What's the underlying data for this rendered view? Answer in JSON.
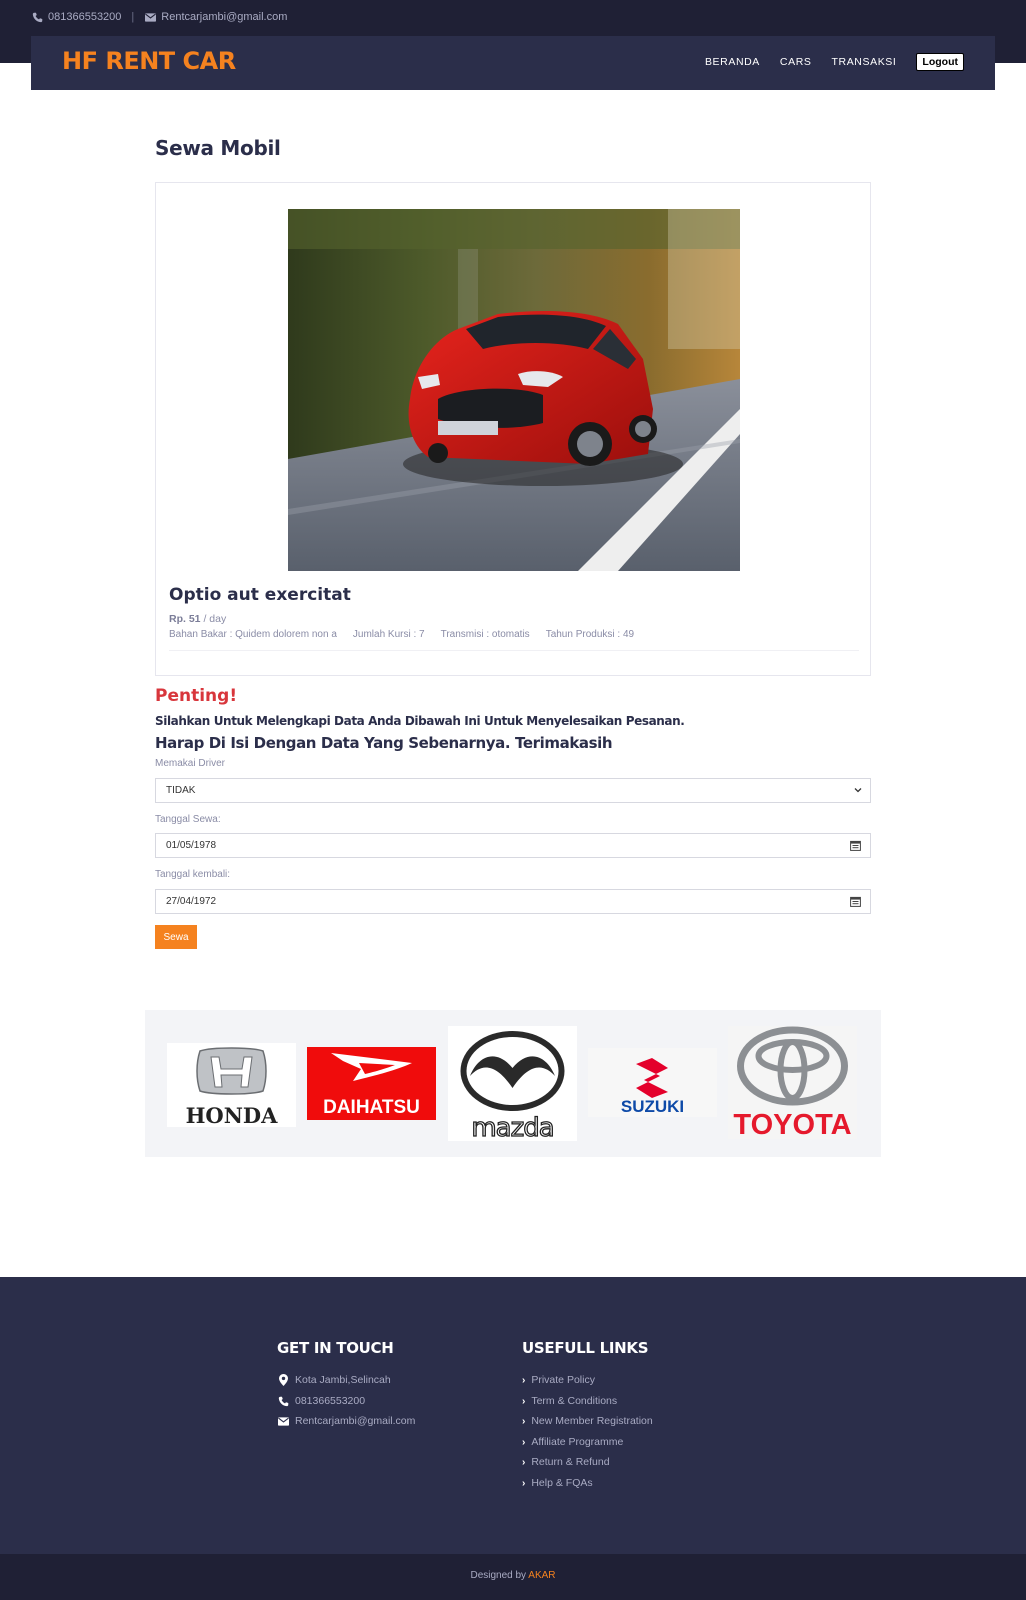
{
  "topbar": {
    "phone": "081366553200",
    "separator": "|",
    "email": "Rentcarjambi@gmail.com"
  },
  "navbar": {
    "brand": "HF RENT CAR",
    "links": [
      "BERANDA",
      "CARS",
      "TRANSAKSI"
    ],
    "logout_label": "Logout"
  },
  "page": {
    "title": "Sewa Mobil"
  },
  "car": {
    "name": "Optio aut exercitat",
    "price": "Rp. 51",
    "price_unit": "/ day",
    "bahan_bakar": "Bahan Bakar : Quidem dolorem non a",
    "jumlah_kursi": "Jumlah Kursi : 7",
    "transmisi": "Transmisi : otomatis",
    "tahun_produksi": "Tahun Produksi : 49"
  },
  "notice": {
    "heading": "Penting!",
    "line1": "Silahkan Untuk Melengkapi Data Anda Dibawah Ini Untuk Menyelesaikan Pesanan.",
    "line2": "Harap Di Isi Dengan Data Yang Sebenarnya. Terimakasih"
  },
  "form": {
    "driver_label": "Memakai Driver",
    "driver_value": "TIDAK",
    "tanggal_sewa_label": "Tanggal Sewa:",
    "tanggal_sewa_value": "01/05/1978",
    "tanggal_kembali_label": "Tanggal kembali:",
    "tanggal_kembali_value": "27/04/1972",
    "submit_label": "Sewa"
  },
  "brands": [
    "HONDA",
    "DAIHATSU",
    "mazda",
    "SUZUKI",
    "TOYOTA"
  ],
  "footer": {
    "contact_title": "GET IN TOUCH",
    "address": "Kota Jambi,Selincah",
    "phone": "081366553200",
    "email": "Rentcarjambi@gmail.com",
    "links_title": "USEFULL LINKS",
    "links": [
      "Private Policy",
      "Term & Conditions",
      "New Member Registration",
      "Affiliate Programme",
      "Return & Refund",
      "Help & FQAs"
    ],
    "credit_prefix": "Designed by",
    "credit_name": "AKAR"
  },
  "colors": {
    "accent": "#f5821f",
    "navy": "#2b2e4a",
    "dark": "#1f2035",
    "danger": "#d8363c"
  }
}
